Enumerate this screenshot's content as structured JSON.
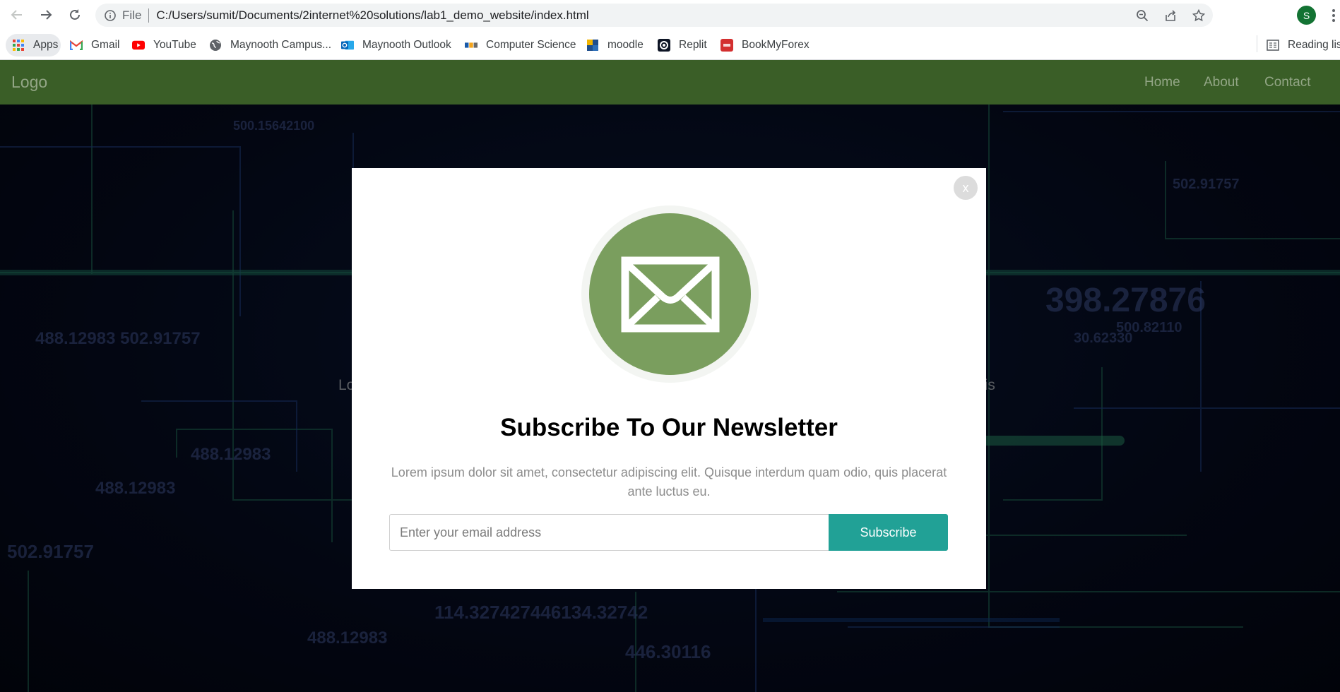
{
  "browser": {
    "url_scheme": "File",
    "url": "C:/Users/sumit/Documents/2internet%20solutions/lab1_demo_website/index.html",
    "profile_initial": "S",
    "bookmarks": [
      {
        "label": "Apps",
        "icon": "apps-grid-icon"
      },
      {
        "label": "Gmail",
        "icon": "gmail-icon"
      },
      {
        "label": "YouTube",
        "icon": "youtube-icon"
      },
      {
        "label": "Maynooth Campus...",
        "icon": "globe-icon"
      },
      {
        "label": "Maynooth Outlook",
        "icon": "outlook-icon"
      },
      {
        "label": "Computer Science",
        "icon": "cs-icon"
      },
      {
        "label": "moodle",
        "icon": "moodle-icon"
      },
      {
        "label": "Replit",
        "icon": "replit-icon"
      },
      {
        "label": "BookMyForex",
        "icon": "bookmyforex-icon"
      }
    ],
    "reading_list": "Reading list"
  },
  "site": {
    "logo": "Logo",
    "nav": [
      "Home",
      "About",
      "Contact"
    ],
    "hero_text_left": "Lo",
    "hero_text_right": "uis",
    "bg_numbers": [
      "500.15642100",
      "488.12983 502.91757",
      "488.12983",
      "488.12983",
      "502.91757",
      "114.327427446134.32742",
      "488.12983",
      "446.30116",
      "398.27876",
      "500.82110",
      "30.62330",
      "502.91757"
    ]
  },
  "modal": {
    "close_label": "x",
    "title": "Subscribe To Our Newsletter",
    "description": "Lorem ipsum dolor sit amet, consectetur adipiscing elit. Quisque interdum quam odio, quis placerat ante luctus eu.",
    "email_placeholder": "Enter your email address",
    "subscribe_label": "Subscribe"
  },
  "colors": {
    "nav_bg": "#3a5e27",
    "envelope_circle": "#7a9e5e",
    "subscribe_button": "#21a196"
  }
}
